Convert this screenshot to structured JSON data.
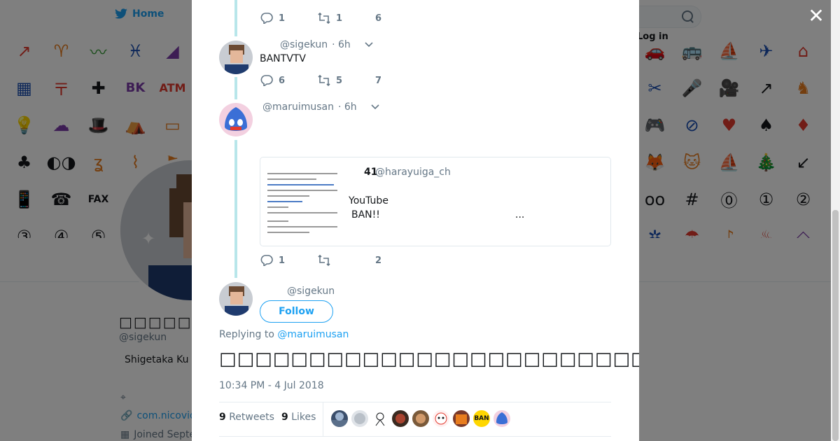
{
  "nav": {
    "home_label": "Home",
    "login_label": "Log in"
  },
  "profile": {
    "display_name": "□□□□□□□□□□□",
    "handle": "@sigekun",
    "bio": "Shigetaka Ku",
    "link": "com.nicovid",
    "joined": "Joined Septe"
  },
  "thread": [
    {
      "replies": "1",
      "retweets": "1",
      "likes": "6"
    },
    {
      "handle": "@sigekun",
      "time": "· 6h",
      "text": "BANTVTV",
      "replies": "6",
      "retweets": "5",
      "likes": "7"
    },
    {
      "handle": "@maruimusan",
      "time": "· 6h",
      "quote": {
        "count": "41",
        "handle": "@harayuiga_ch",
        "line1": "YouTube",
        "line2": "BAN!!",
        "more": "..."
      },
      "replies": "1",
      "retweets": "",
      "likes": "2"
    }
  ],
  "main_tweet": {
    "handle": "@sigekun",
    "follow_label": "Follow",
    "replying_prefix": "Replying to",
    "replying_to": "@maruimusan",
    "text": "□□□□□□□□□□□□□□□□□□□□□□□□□□□□□□□□□□□□□□□□□□□",
    "timestamp": "10:34 PM - 4 Jul 2018",
    "retweets_count": "9",
    "retweets_label": "Retweets",
    "likes_count": "9",
    "likes_label": "Likes",
    "liker_labels": [
      "BAN"
    ]
  },
  "colors": {
    "accent": "#1da1f2",
    "thread_line": "#b8e6ea",
    "overlay": "rgba(0,0,0,0.5)"
  }
}
